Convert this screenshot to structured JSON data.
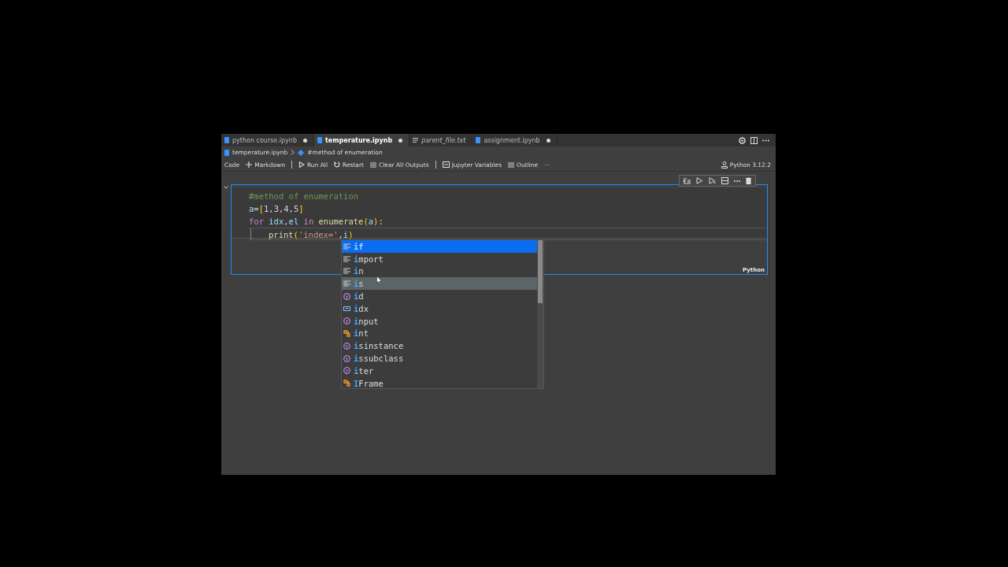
{
  "tabs": [
    {
      "label": "python course.ipynb",
      "kind": "notebook",
      "selected": false,
      "dirty": true,
      "preview": false
    },
    {
      "label": "temperature.ipynb",
      "kind": "notebook",
      "selected": true,
      "dirty": true,
      "preview": false
    },
    {
      "label": "parent_file.txt",
      "kind": "text",
      "selected": false,
      "dirty": false,
      "preview": true
    },
    {
      "label": "assignment.ipynb",
      "kind": "notebook",
      "selected": false,
      "dirty": true,
      "preview": false
    }
  ],
  "breadcrumb": [
    "temperature.ipynb",
    "#method of enumeration"
  ],
  "toolbar": {
    "items": [
      {
        "label": "Code",
        "kind": "plain"
      },
      {
        "label": "Markdown",
        "kind": "add"
      },
      {
        "label": "Run All",
        "kind": "run",
        "divider_before": true
      },
      {
        "label": "Restart",
        "kind": "restart"
      },
      {
        "label": "Clear All Outputs",
        "kind": "clear"
      },
      {
        "label": "Jupyter Variables",
        "kind": "variables",
        "divider_before": true
      },
      {
        "label": "Outline",
        "kind": "outline"
      },
      {
        "label": "···",
        "kind": "more"
      }
    ],
    "kernel": "Python 3.12.2"
  },
  "cell": {
    "language": "Python",
    "lines": [
      [
        {
          "text": "#method of enumeration",
          "kind": "comment"
        }
      ],
      [
        {
          "text": "a",
          "kind": "variable"
        },
        {
          "text": "=",
          "kind": "plain"
        },
        {
          "text": "[",
          "kind": "bracket"
        },
        {
          "text": "1,3,4,5",
          "kind": "plain"
        },
        {
          "text": "]",
          "kind": "bracket"
        }
      ],
      [
        {
          "text": "for",
          "kind": "keyword"
        },
        {
          "text": " idx",
          "kind": "variable"
        },
        {
          "text": ",",
          "kind": "plain"
        },
        {
          "text": "el",
          "kind": "variable"
        },
        {
          "text": " in",
          "kind": "keyword"
        },
        {
          "text": " enumerate",
          "kind": "function"
        },
        {
          "text": "(",
          "kind": "bracket"
        },
        {
          "text": "a",
          "kind": "variable"
        },
        {
          "text": ")",
          "kind": "bracket"
        },
        {
          "text": ":",
          "kind": "plain"
        }
      ],
      {
        "indented": true,
        "tokens": [
          {
            "text": "print",
            "kind": "function"
          },
          {
            "text": "(",
            "kind": "bracket"
          },
          {
            "text": "'index='",
            "kind": "string"
          },
          {
            "text": ",",
            "kind": "plain"
          },
          {
            "text": "i",
            "kind": "variable"
          },
          {
            "text": ")",
            "kind": "bracket"
          }
        ]
      }
    ]
  },
  "suggestions": {
    "items": [
      {
        "match": "i",
        "rest": "f",
        "kind": "keyword",
        "selected": true,
        "hovered": false
      },
      {
        "match": "i",
        "rest": "mport",
        "kind": "keyword",
        "selected": false,
        "hovered": false
      },
      {
        "match": "i",
        "rest": "n",
        "kind": "keyword",
        "selected": false,
        "hovered": false
      },
      {
        "match": "i",
        "rest": "s",
        "kind": "keyword",
        "selected": false,
        "hovered": true
      },
      {
        "match": "i",
        "rest": "d",
        "kind": "function",
        "selected": false,
        "hovered": false
      },
      {
        "match": "i",
        "rest": "dx",
        "kind": "variable",
        "selected": false,
        "hovered": false
      },
      {
        "match": "i",
        "rest": "nput",
        "kind": "function",
        "selected": false,
        "hovered": false
      },
      {
        "match": "i",
        "rest": "nt",
        "kind": "class",
        "selected": false,
        "hovered": false
      },
      {
        "match": "i",
        "rest": "sinstance",
        "kind": "function",
        "selected": false,
        "hovered": false
      },
      {
        "match": "i",
        "rest": "ssubclass",
        "kind": "function",
        "selected": false,
        "hovered": false
      },
      {
        "match": "i",
        "rest": "ter",
        "kind": "function",
        "selected": false,
        "hovered": false
      },
      {
        "match": "I",
        "rest": "Frame",
        "kind": "class",
        "selected": false,
        "hovered": false
      }
    ]
  }
}
